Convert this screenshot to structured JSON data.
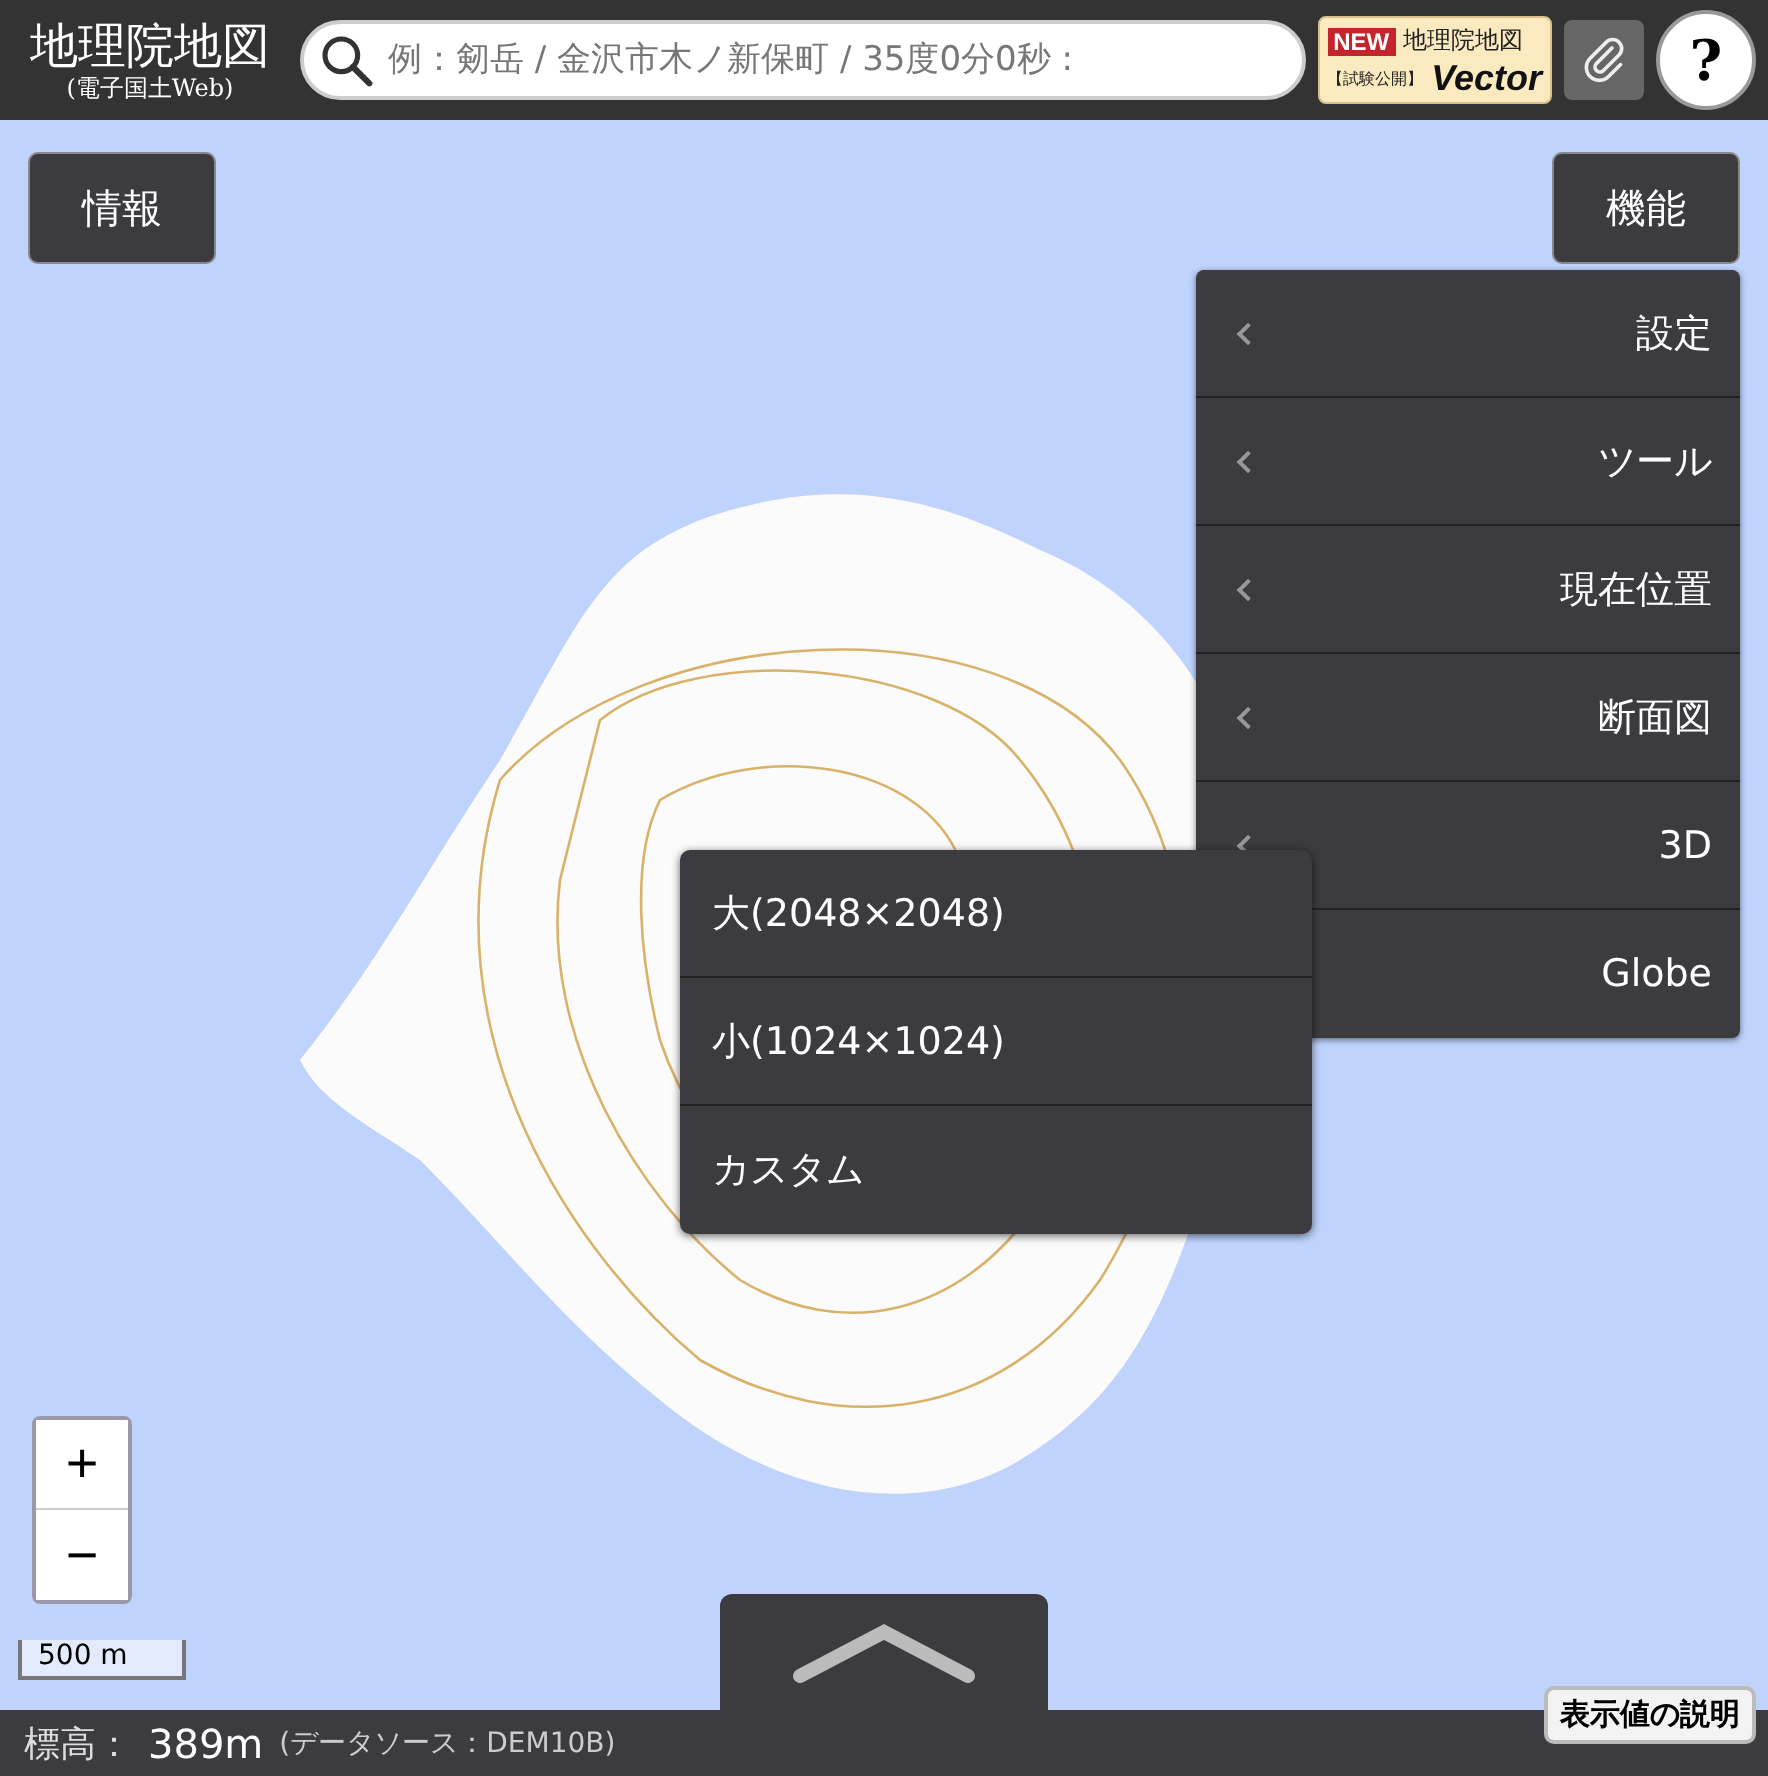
{
  "header": {
    "logo_title": "地理院地図",
    "logo_subtitle": "(電子国土Web)",
    "search": {
      "placeholder": "例：剱岳 / 金沢市木ノ新保町 / 35度0分0秒 :"
    },
    "vector_banner": {
      "badge": "NEW",
      "note": "【試験公開】",
      "title": "地理院地図",
      "brand": "Vector"
    },
    "help_button": "?"
  },
  "info_button": "情報",
  "function_button": "機能",
  "function_menu": [
    {
      "label": "設定"
    },
    {
      "label": "ツール"
    },
    {
      "label": "現在位置"
    },
    {
      "label": "断面図"
    },
    {
      "label": "3D"
    },
    {
      "label": "Globe"
    }
  ],
  "size_menu": [
    {
      "label": "大(2048×2048)"
    },
    {
      "label": "小(1024×1024)"
    },
    {
      "label": "カスタム"
    }
  ],
  "zoom": {
    "in": "+",
    "out": "−"
  },
  "scale": "500 m",
  "status_bar": {
    "label": "標高：",
    "value": "389m",
    "source": "(データソース：DEM10B)",
    "explain_button": "表示値の説明"
  }
}
